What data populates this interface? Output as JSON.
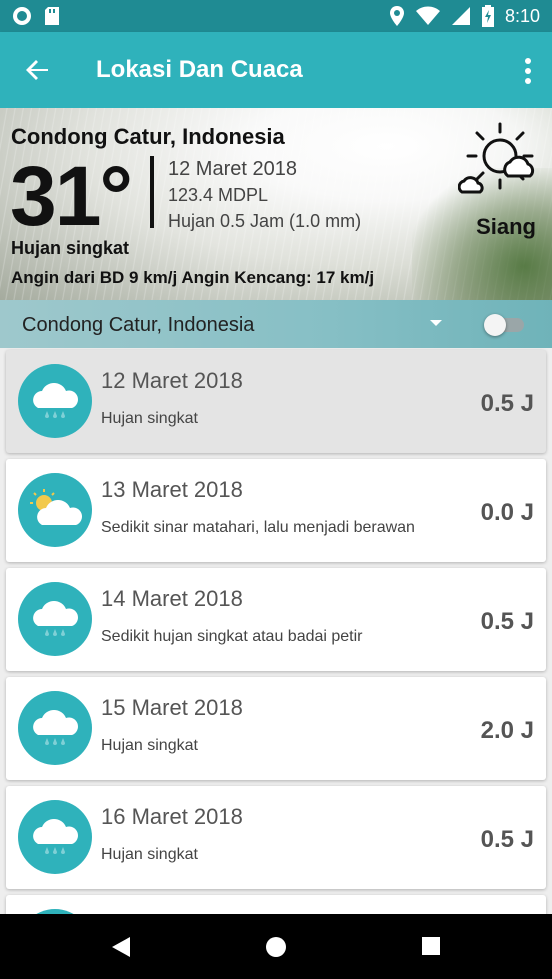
{
  "status_bar": {
    "time": "8:10"
  },
  "app_bar": {
    "title": "Lokasi Dan Cuaca",
    "back_icon": "arrow-back-icon",
    "menu_icon": "overflow-menu-icon"
  },
  "current": {
    "location": "Condong Catur, Indonesia",
    "temperature": "31°",
    "date": "12 Maret 2018",
    "elevation": "123.4 MDPL",
    "rain": "Hujan 0.5 Jam (1.0 mm)",
    "condition": "Hujan singkat",
    "wind": "Angin dari BD 9 km/j Angin Kencang: 17 km/j",
    "period": "Siang",
    "icon": "sun-cloud-icon"
  },
  "location_selector": {
    "value": "Condong Catur, Indonesia",
    "toggle_on": false
  },
  "forecast": [
    {
      "date": "12 Maret 2018",
      "desc": "Hujan singkat",
      "value": "0.5 J",
      "icon": "rain-cloud-icon",
      "selected": true
    },
    {
      "date": "13 Maret 2018",
      "desc": "Sedikit sinar matahari, lalu menjadi berawan",
      "value": "0.0 J",
      "icon": "sun-cloud-icon",
      "selected": false
    },
    {
      "date": "14 Maret 2018",
      "desc": "Sedikit hujan singkat atau badai petir",
      "value": "0.5 J",
      "icon": "rain-cloud-icon",
      "selected": false
    },
    {
      "date": "15 Maret 2018",
      "desc": "Hujan singkat",
      "value": "2.0 J",
      "icon": "rain-cloud-icon",
      "selected": false
    },
    {
      "date": "16 Maret 2018",
      "desc": "Hujan singkat",
      "value": "0.5 J",
      "icon": "rain-cloud-icon",
      "selected": false
    }
  ],
  "colors": {
    "app_bar": "#2fb2bb",
    "status_bar": "#1f8b93",
    "icon_circle": "#2fb2bb"
  }
}
